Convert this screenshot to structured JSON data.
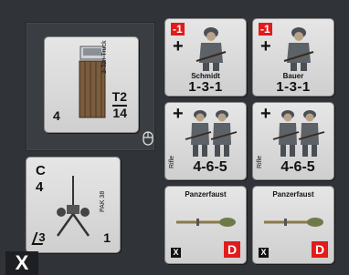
{
  "truck": {
    "vehicle_label": "3-Ton Truck",
    "left_value": "4",
    "top_value": "T2",
    "bottom_value": "14"
  },
  "pak": {
    "class": "C",
    "value": "4",
    "range": "3",
    "right_value": "1",
    "vehicle_label": "PAK 38"
  },
  "soldiers": [
    {
      "modifier": "-1",
      "name": "Schmidt",
      "stats": "1-3-1"
    },
    {
      "modifier": "-1",
      "name": "Bauer",
      "stats": "1-3-1"
    }
  ],
  "squads": [
    {
      "weapon": "Rifle",
      "stats": "4-6-5"
    },
    {
      "weapon": "Rifle",
      "stats": "4-6-5"
    }
  ],
  "weapons": [
    {
      "name": "Panzerfaust",
      "x_label": "X",
      "d_label": "D"
    },
    {
      "name": "Panzerfaust",
      "x_label": "X",
      "d_label": "D"
    }
  ],
  "controls": {
    "close_label": "X"
  },
  "colors": {
    "red_badge": "#e21b1b",
    "counter_bg": "#dcdcdc",
    "panel_bg": "#303337"
  },
  "icons": [
    "mouse-icon",
    "close-icon",
    "plus-icon"
  ]
}
